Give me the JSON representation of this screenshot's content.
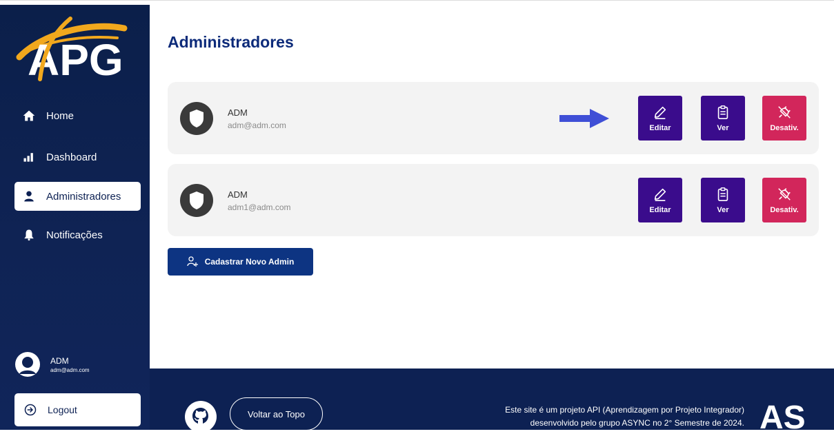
{
  "sidebar": {
    "logo_text": "APG",
    "items": [
      {
        "label": "Home",
        "icon": "home-icon"
      },
      {
        "label": "Dashboard",
        "icon": "bar-chart-icon"
      },
      {
        "label": "Administradores",
        "icon": "user-icon",
        "active": true
      },
      {
        "label": "Notificações",
        "icon": "bell-icon"
      }
    ],
    "user": {
      "name": "ADM",
      "email": "adm@adm.com"
    },
    "logout_label": "Logout"
  },
  "main": {
    "title": "Administradores",
    "admins": [
      {
        "name": "ADM",
        "email": "adm@adm.com"
      },
      {
        "name": "ADM",
        "email": "adm1@adm.com"
      }
    ],
    "actions": {
      "edit": "Editar",
      "view": "Ver",
      "deactivate": "Desativ."
    },
    "new_admin_label": "Cadastrar Novo Admin"
  },
  "footer": {
    "top_button": "Voltar ao Topo",
    "text_line1": "Este site é um projeto API (Aprendizagem por Projeto Integrador)",
    "text_line2": "desenvolvido pelo grupo ASYNC no 2° Semestre de 2024.",
    "brand": "AS"
  },
  "colors": {
    "sidebar_bg": "#0d2153",
    "accent_purple": "#3a0c8c",
    "danger": "#d2265b",
    "primary_blue": "#0d3482",
    "title_blue": "#0d2b7a",
    "arrow_blue": "#3f4fd6",
    "logo_gold": "#f2a81d"
  }
}
